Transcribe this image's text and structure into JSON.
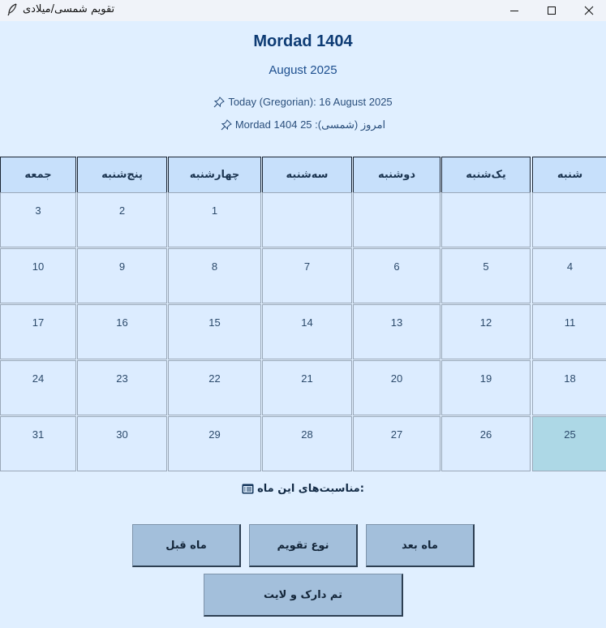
{
  "window": {
    "title": "تقویم شمسی/میلادی",
    "app_icon": "feather-pen-icon",
    "controls": {
      "minimize": "minimize-icon",
      "maximize": "maximize-icon",
      "close": "close-icon"
    }
  },
  "header": {
    "month_title": "Mordad 1404",
    "gregorian_month": "August 2025",
    "today_gregorian": "Today (Gregorian): 16 August 2025",
    "today_jalali": "امروز (شمسی): 25 Mordad 1404",
    "today_icon": "pushpin-icon"
  },
  "calendar": {
    "weekdays": [
      "شنبه",
      "یک‌شنبه",
      "دوشنبه",
      "سه‌شنبه",
      "چهارشنبه",
      "پنج‌شنبه",
      "جمعه"
    ],
    "weeks": [
      [
        "",
        "",
        "",
        "",
        "1",
        "2",
        "3"
      ],
      [
        "4",
        "5",
        "6",
        "7",
        "8",
        "9",
        "10"
      ],
      [
        "11",
        "12",
        "13",
        "14",
        "15",
        "16",
        "17"
      ],
      [
        "18",
        "19",
        "20",
        "21",
        "22",
        "23",
        "24"
      ],
      [
        "25",
        "26",
        "27",
        "28",
        "29",
        "30",
        "31"
      ]
    ],
    "today_day": "25",
    "colors": {
      "header_bg": "#c7e0fb",
      "cell_bg": "#dcecff",
      "today_bg": "#add8e6",
      "page_bg": "#e0efff"
    }
  },
  "events": {
    "label": ":مناسبت‌های این ماه",
    "icon": "calendar-list-icon"
  },
  "buttons": {
    "next_month": "ماه بعد",
    "calendar_type": "نوع تقویم",
    "prev_month": "ماه قبل",
    "theme_toggle": "تم دارک و لایت"
  }
}
